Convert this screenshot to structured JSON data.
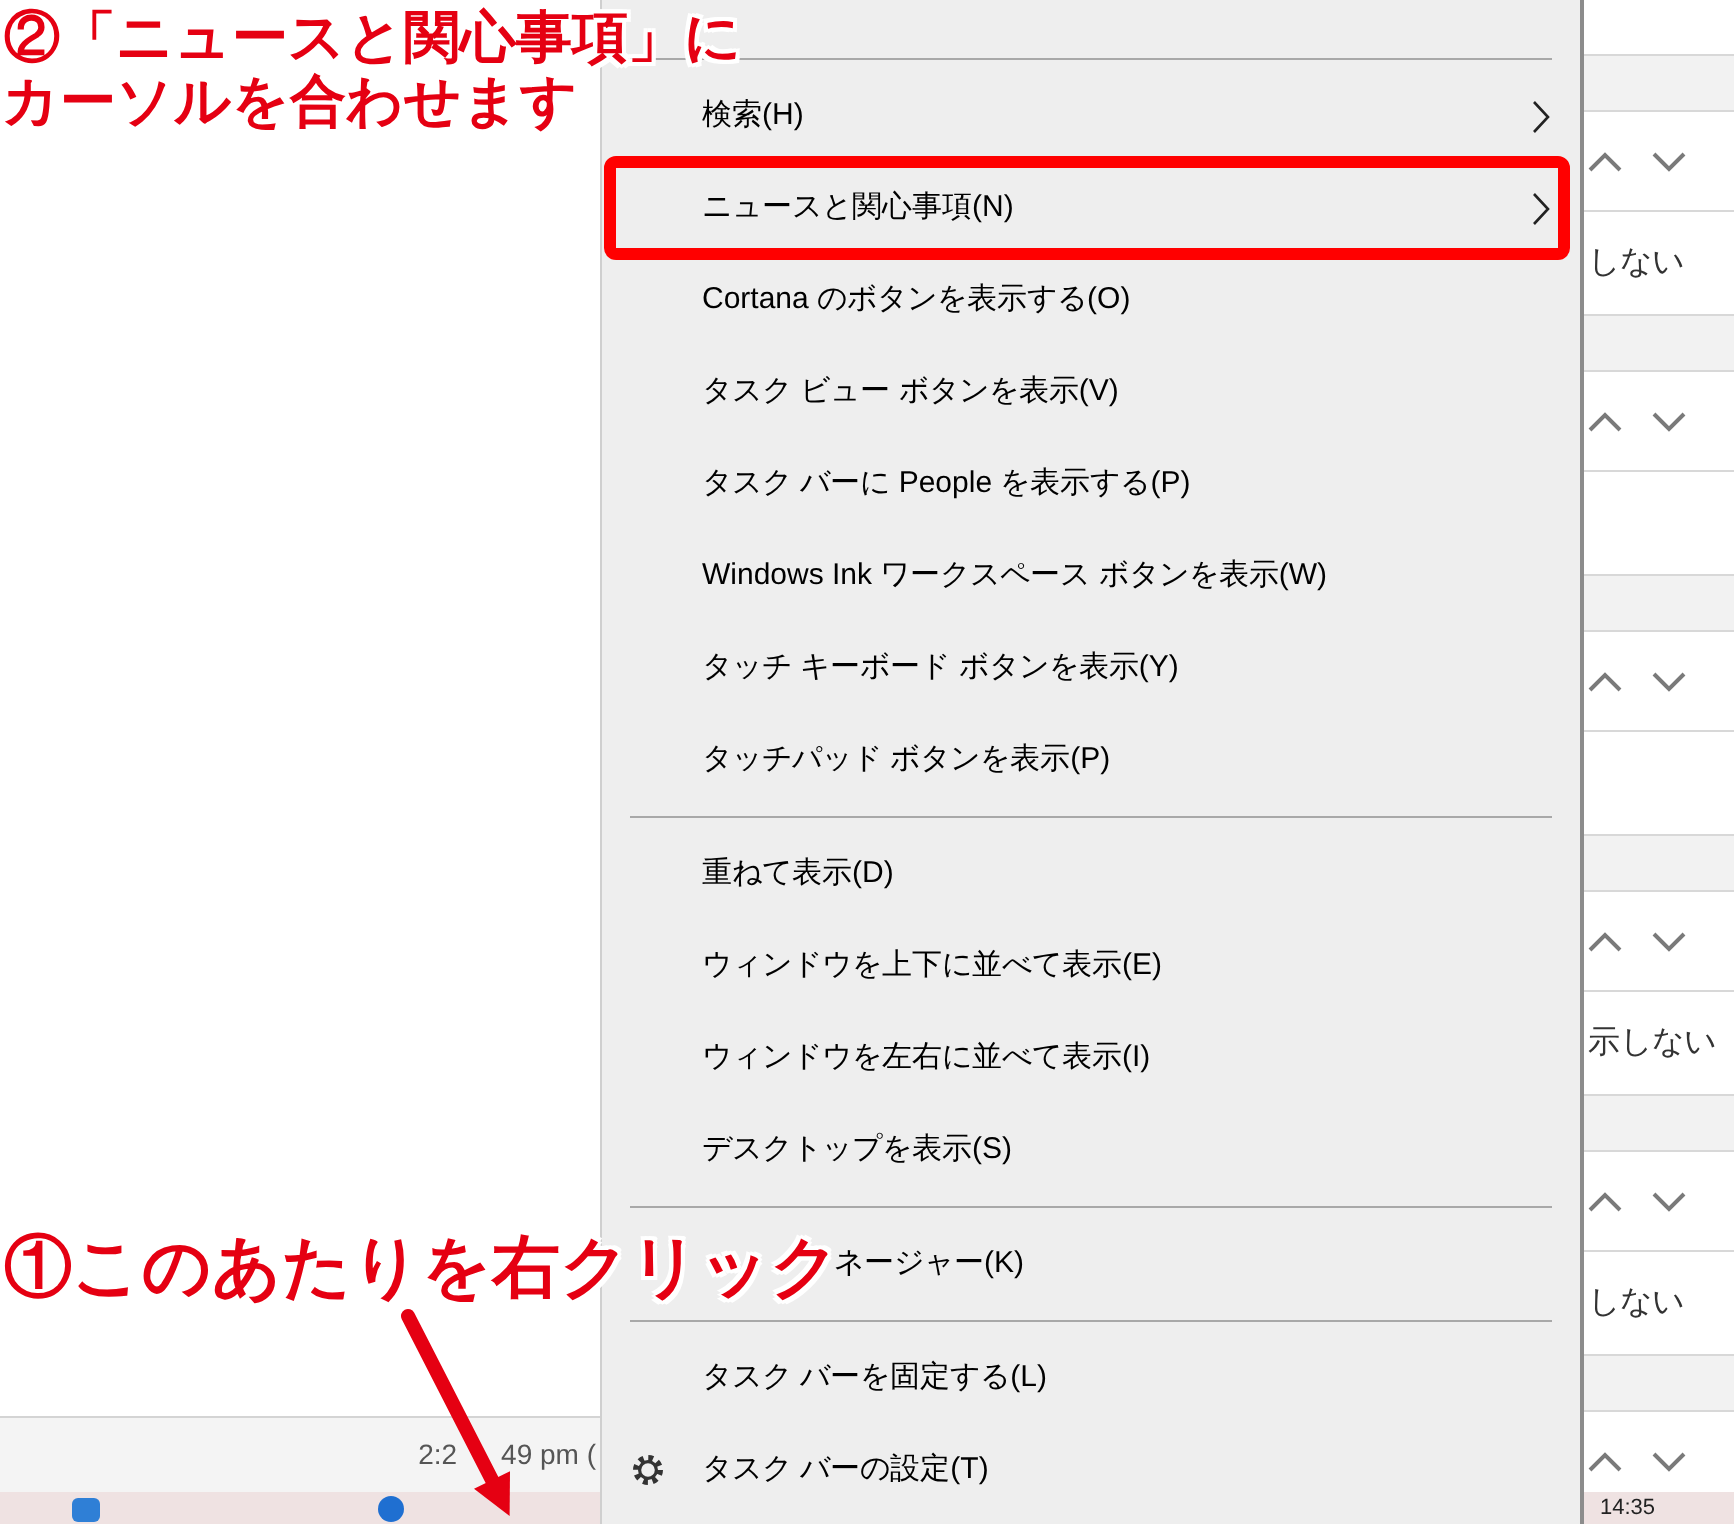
{
  "callouts": {
    "top": [
      "②「ニュースと関心事項」に",
      "カーソルを合わせます"
    ],
    "bottom": "①このあたりを右クリック"
  },
  "background_window": {
    "time_fragments": [
      "2:2",
      "49 pm ("
    ]
  },
  "context_menu": {
    "items": [
      {
        "kind": "separator"
      },
      {
        "kind": "submenu",
        "label": "検索(H)",
        "circled": false
      },
      {
        "kind": "submenu",
        "label": "ニュースと関心事項(N)",
        "circled": true
      },
      {
        "kind": "item",
        "label": "Cortana のボタンを表示する(O)",
        "circled": false
      },
      {
        "kind": "item",
        "label": "タスク ビュー ボタンを表示(V)",
        "circled": false
      },
      {
        "kind": "item",
        "label": "タスク バーに People を表示する(P)",
        "circled": false
      },
      {
        "kind": "item",
        "label": "Windows Ink ワークスペース ボタンを表示(W)",
        "circled": false
      },
      {
        "kind": "item",
        "label": "タッチ キーボード ボタンを表示(Y)",
        "circled": false
      },
      {
        "kind": "item",
        "label": "タッチパッド ボタンを表示(P)",
        "circled": false
      },
      {
        "kind": "separator"
      },
      {
        "kind": "item",
        "label": "重ねて表示(D)",
        "circled": false
      },
      {
        "kind": "item",
        "label": "ウィンドウを上下に並べて表示(E)",
        "circled": false
      },
      {
        "kind": "item",
        "label": "ウィンドウを左右に並べて表示(I)",
        "circled": false
      },
      {
        "kind": "item",
        "label": "デスクトップを表示(S)",
        "circled": false
      },
      {
        "kind": "separator"
      },
      {
        "kind": "obscured",
        "label": "ネージャー(K)",
        "circled": false
      },
      {
        "kind": "separator"
      },
      {
        "kind": "item",
        "label": "タスク バーを固定する(L)",
        "circled": false
      },
      {
        "kind": "settings",
        "label": "タスク バーの設定(T)",
        "circled": false
      }
    ]
  },
  "notifications": [
    {
      "kind": "entry",
      "text": "しない"
    },
    {
      "kind": "entry"
    },
    {
      "kind": "entry"
    },
    {
      "kind": "entry",
      "text": "示しない"
    },
    {
      "kind": "entry",
      "text": "しない"
    },
    {
      "kind": "entry"
    }
  ],
  "taskbar": {
    "clock": "14:35"
  }
}
